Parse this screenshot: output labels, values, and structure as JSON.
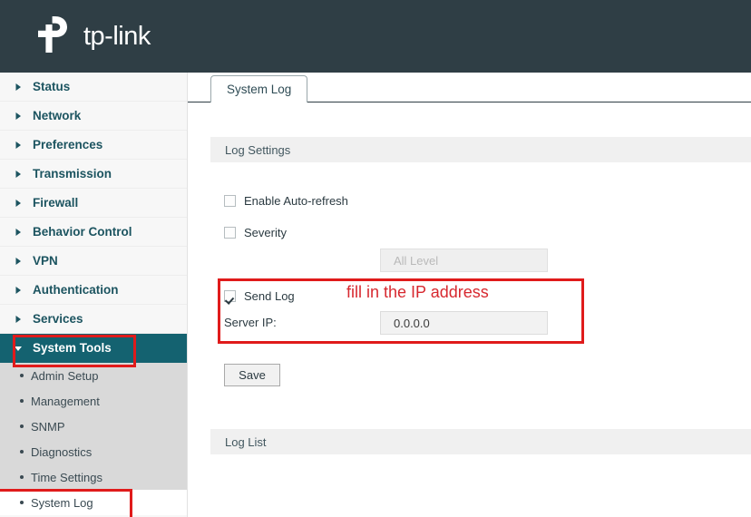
{
  "brand": {
    "name": "tp-link",
    "logo_icon": "tp-link-logo-icon",
    "header_bg": "#2f3e45"
  },
  "sidebar": {
    "items": [
      {
        "label": "Status",
        "icon": "chevron-right-icon",
        "active": false,
        "boxed": false
      },
      {
        "label": "Network",
        "icon": "chevron-right-icon",
        "active": false,
        "boxed": false
      },
      {
        "label": "Preferences",
        "icon": "chevron-right-icon",
        "active": false,
        "boxed": false
      },
      {
        "label": "Transmission",
        "icon": "chevron-right-icon",
        "active": false,
        "boxed": false
      },
      {
        "label": "Firewall",
        "icon": "chevron-right-icon",
        "active": false,
        "boxed": false
      },
      {
        "label": "Behavior Control",
        "icon": "chevron-right-icon",
        "active": false,
        "boxed": false
      },
      {
        "label": "VPN",
        "icon": "chevron-right-icon",
        "active": false,
        "boxed": false
      },
      {
        "label": "Authentication",
        "icon": "chevron-right-icon",
        "active": false,
        "boxed": false
      },
      {
        "label": "Services",
        "icon": "chevron-right-icon",
        "active": false,
        "boxed": false
      },
      {
        "label": "System Tools",
        "icon": "chevron-down-icon",
        "active": true,
        "boxed": true
      }
    ],
    "submenu": [
      {
        "label": "Admin Setup",
        "selected": false
      },
      {
        "label": "Management",
        "selected": false
      },
      {
        "label": "SNMP",
        "selected": false
      },
      {
        "label": "Diagnostics",
        "selected": false
      },
      {
        "label": "Time Settings",
        "selected": false
      },
      {
        "label": "System Log",
        "selected": true
      }
    ],
    "active_color": "#146270",
    "link_color": "#1c5460",
    "submenu_bg": "#d9d9d9"
  },
  "tabs": [
    {
      "label": "System Log",
      "active": true
    }
  ],
  "main": {
    "sections": {
      "log_settings_title": "Log Settings",
      "log_list_title": "Log List"
    },
    "checkboxes": [
      {
        "label": "Enable Auto-refresh",
        "checked": false
      },
      {
        "label": "Severity",
        "checked": false
      },
      {
        "label": "Send Log",
        "checked": true
      }
    ],
    "severity_select": {
      "value": "All Level",
      "disabled": true,
      "options": [
        "All Level"
      ]
    },
    "server_ip": {
      "label": "Server IP:",
      "value": "0.0.0.0",
      "placeholder": "0.0.0.0"
    },
    "save_label": "Save"
  },
  "annotations": {
    "instruction": "fill in the IP address",
    "highlight_color": "#e01b1b",
    "text_color": "#d7282f"
  }
}
